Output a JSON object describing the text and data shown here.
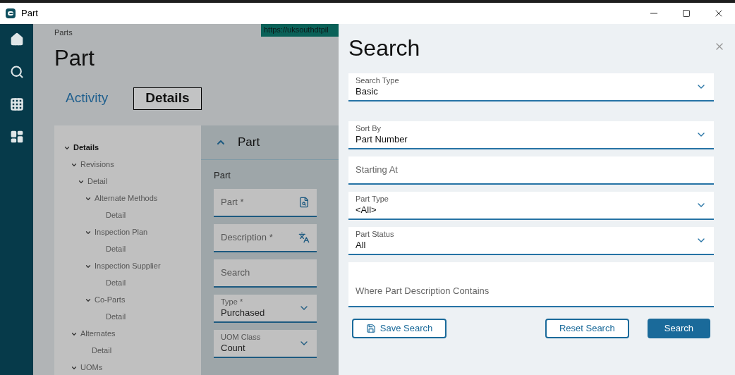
{
  "window": {
    "title": "Part"
  },
  "breadcrumb": "Parts",
  "url_tooltip": "https://uksouthdtpil",
  "page_title": "Part",
  "tabs": [
    {
      "label": "Activity",
      "selected": false
    },
    {
      "label": "Details",
      "selected": true
    }
  ],
  "tree": [
    {
      "label": "Details",
      "selected": true,
      "expanded": true,
      "children": [
        {
          "label": "Revisions",
          "selected": false,
          "expanded": true,
          "children": [
            {
              "label": "Detail",
              "selected": false,
              "expanded": true,
              "children": [
                {
                  "label": "Alternate Methods",
                  "selected": false,
                  "expanded": true,
                  "children": [
                    {
                      "label": "Detail",
                      "selected": false
                    }
                  ]
                },
                {
                  "label": "Inspection Plan",
                  "selected": false,
                  "expanded": true,
                  "children": [
                    {
                      "label": "Detail",
                      "selected": false
                    }
                  ]
                },
                {
                  "label": "Inspection Supplier",
                  "selected": false,
                  "expanded": true,
                  "children": [
                    {
                      "label": "Detail",
                      "selected": false
                    }
                  ]
                },
                {
                  "label": "Co-Parts",
                  "selected": false,
                  "expanded": true,
                  "children": [
                    {
                      "label": "Detail",
                      "selected": false
                    }
                  ]
                }
              ]
            }
          ]
        },
        {
          "label": "Alternates",
          "selected": false,
          "expanded": true,
          "children": [
            {
              "label": "Detail",
              "selected": false
            }
          ]
        },
        {
          "label": "UOMs",
          "selected": false,
          "expanded": true
        }
      ]
    }
  ],
  "section": {
    "title": "Part",
    "expanded": true,
    "group_label": "Part",
    "fields": [
      {
        "kind": "lookup",
        "placeholder": "Part *"
      },
      {
        "kind": "translate",
        "placeholder": "Description *"
      },
      {
        "kind": "text",
        "placeholder": "Search"
      },
      {
        "kind": "select",
        "label": "Type *",
        "value": "Purchased"
      },
      {
        "kind": "select",
        "label": "UOM Class",
        "value": "Count"
      }
    ]
  },
  "search": {
    "title": "Search",
    "fields": [
      {
        "kind": "select",
        "label": "Search Type",
        "value": "Basic"
      },
      {
        "kind": "select",
        "label": "Sort By",
        "value": "Part Number"
      },
      {
        "kind": "text",
        "placeholder": "Starting At"
      },
      {
        "kind": "select",
        "label": "Part Type",
        "value": "<All>"
      },
      {
        "kind": "select",
        "label": "Part Status",
        "value": "All"
      },
      {
        "kind": "textarea",
        "placeholder": "Where Part Description Contains"
      }
    ],
    "buttons": [
      {
        "label": "Save Search",
        "kind": "save"
      },
      {
        "label": "Reset Search",
        "kind": "outline"
      },
      {
        "label": "Search",
        "kind": "primary"
      }
    ]
  }
}
